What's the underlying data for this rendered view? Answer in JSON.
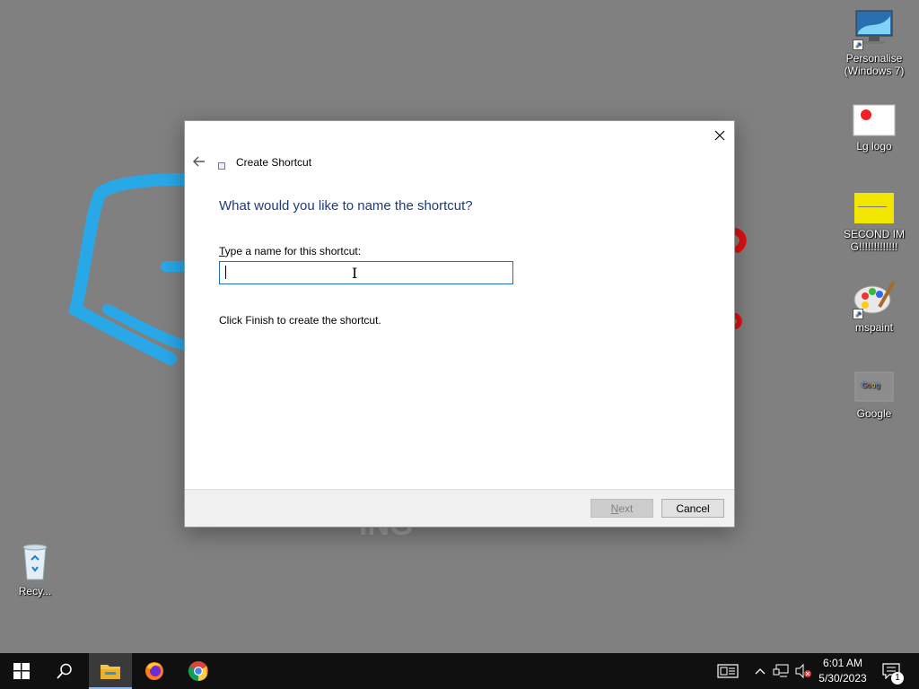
{
  "desktop": {
    "icons": [
      {
        "label": "Personalise (Windows 7)",
        "icon": "personalise-icon"
      },
      {
        "label": "Lg logo",
        "icon": "image-icon"
      },
      {
        "label": "SECOND IMG!!!!!!!!!!!!!",
        "icon": "image-icon"
      },
      {
        "label": "mspaint",
        "icon": "mspaint-icon"
      },
      {
        "label": "Google",
        "icon": "image-icon"
      },
      {
        "label": "Recy...",
        "icon": "recycle-bin-icon"
      }
    ],
    "wallpaper_text": "ING"
  },
  "dialog": {
    "title": "Create Shortcut",
    "heading": "What would you like to name the shortcut?",
    "field_label_prefix": "T",
    "field_label_rest": "ype a name for this shortcut:",
    "input_value": "",
    "instruction": "Click Finish to create the shortcut.",
    "next_label_prefix": "N",
    "next_label_rest": "ext",
    "cancel_label": "Cancel",
    "heading_color": "#1e3b7a"
  },
  "taskbar": {
    "time": "6:01 AM",
    "date": "5/30/2023",
    "notification_count": "1",
    "apps": [
      "start",
      "search",
      "file-explorer",
      "firefox",
      "chrome"
    ]
  }
}
